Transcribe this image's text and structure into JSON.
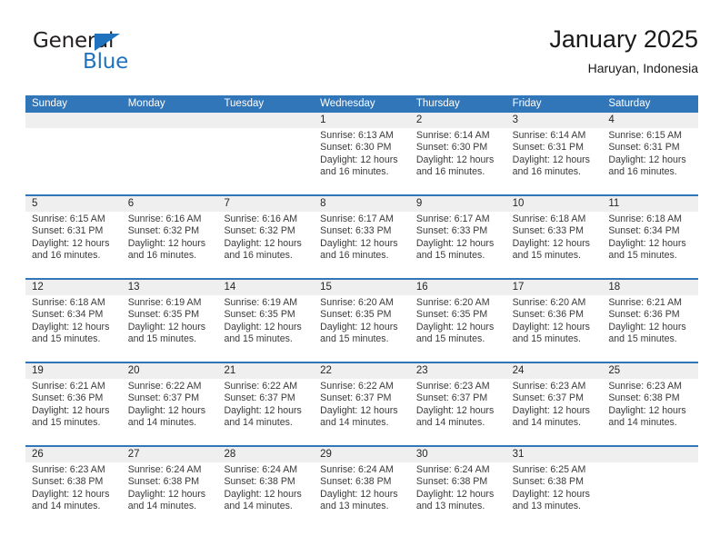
{
  "brand": {
    "name_part1": "General",
    "name_part2": "Blue",
    "triangle_color": "#1f72bd"
  },
  "header": {
    "title": "January 2025",
    "subtitle": "Haruyan, Indonesia"
  },
  "theme": {
    "header_blue": "#3176b9",
    "daynum_band": "#efefef",
    "text": "#3a3a3a"
  },
  "weekdays": [
    "Sunday",
    "Monday",
    "Tuesday",
    "Wednesday",
    "Thursday",
    "Friday",
    "Saturday"
  ],
  "weeks": [
    [
      {
        "day": "",
        "lines": [
          "",
          "",
          "",
          ""
        ]
      },
      {
        "day": "",
        "lines": [
          "",
          "",
          "",
          ""
        ]
      },
      {
        "day": "",
        "lines": [
          "",
          "",
          "",
          ""
        ]
      },
      {
        "day": "1",
        "lines": [
          "Sunrise: 6:13 AM",
          "Sunset: 6:30 PM",
          "Daylight: 12 hours",
          "and 16 minutes."
        ]
      },
      {
        "day": "2",
        "lines": [
          "Sunrise: 6:14 AM",
          "Sunset: 6:30 PM",
          "Daylight: 12 hours",
          "and 16 minutes."
        ]
      },
      {
        "day": "3",
        "lines": [
          "Sunrise: 6:14 AM",
          "Sunset: 6:31 PM",
          "Daylight: 12 hours",
          "and 16 minutes."
        ]
      },
      {
        "day": "4",
        "lines": [
          "Sunrise: 6:15 AM",
          "Sunset: 6:31 PM",
          "Daylight: 12 hours",
          "and 16 minutes."
        ]
      }
    ],
    [
      {
        "day": "5",
        "lines": [
          "Sunrise: 6:15 AM",
          "Sunset: 6:31 PM",
          "Daylight: 12 hours",
          "and 16 minutes."
        ]
      },
      {
        "day": "6",
        "lines": [
          "Sunrise: 6:16 AM",
          "Sunset: 6:32 PM",
          "Daylight: 12 hours",
          "and 16 minutes."
        ]
      },
      {
        "day": "7",
        "lines": [
          "Sunrise: 6:16 AM",
          "Sunset: 6:32 PM",
          "Daylight: 12 hours",
          "and 16 minutes."
        ]
      },
      {
        "day": "8",
        "lines": [
          "Sunrise: 6:17 AM",
          "Sunset: 6:33 PM",
          "Daylight: 12 hours",
          "and 16 minutes."
        ]
      },
      {
        "day": "9",
        "lines": [
          "Sunrise: 6:17 AM",
          "Sunset: 6:33 PM",
          "Daylight: 12 hours",
          "and 15 minutes."
        ]
      },
      {
        "day": "10",
        "lines": [
          "Sunrise: 6:18 AM",
          "Sunset: 6:33 PM",
          "Daylight: 12 hours",
          "and 15 minutes."
        ]
      },
      {
        "day": "11",
        "lines": [
          "Sunrise: 6:18 AM",
          "Sunset: 6:34 PM",
          "Daylight: 12 hours",
          "and 15 minutes."
        ]
      }
    ],
    [
      {
        "day": "12",
        "lines": [
          "Sunrise: 6:18 AM",
          "Sunset: 6:34 PM",
          "Daylight: 12 hours",
          "and 15 minutes."
        ]
      },
      {
        "day": "13",
        "lines": [
          "Sunrise: 6:19 AM",
          "Sunset: 6:35 PM",
          "Daylight: 12 hours",
          "and 15 minutes."
        ]
      },
      {
        "day": "14",
        "lines": [
          "Sunrise: 6:19 AM",
          "Sunset: 6:35 PM",
          "Daylight: 12 hours",
          "and 15 minutes."
        ]
      },
      {
        "day": "15",
        "lines": [
          "Sunrise: 6:20 AM",
          "Sunset: 6:35 PM",
          "Daylight: 12 hours",
          "and 15 minutes."
        ]
      },
      {
        "day": "16",
        "lines": [
          "Sunrise: 6:20 AM",
          "Sunset: 6:35 PM",
          "Daylight: 12 hours",
          "and 15 minutes."
        ]
      },
      {
        "day": "17",
        "lines": [
          "Sunrise: 6:20 AM",
          "Sunset: 6:36 PM",
          "Daylight: 12 hours",
          "and 15 minutes."
        ]
      },
      {
        "day": "18",
        "lines": [
          "Sunrise: 6:21 AM",
          "Sunset: 6:36 PM",
          "Daylight: 12 hours",
          "and 15 minutes."
        ]
      }
    ],
    [
      {
        "day": "19",
        "lines": [
          "Sunrise: 6:21 AM",
          "Sunset: 6:36 PM",
          "Daylight: 12 hours",
          "and 15 minutes."
        ]
      },
      {
        "day": "20",
        "lines": [
          "Sunrise: 6:22 AM",
          "Sunset: 6:37 PM",
          "Daylight: 12 hours",
          "and 14 minutes."
        ]
      },
      {
        "day": "21",
        "lines": [
          "Sunrise: 6:22 AM",
          "Sunset: 6:37 PM",
          "Daylight: 12 hours",
          "and 14 minutes."
        ]
      },
      {
        "day": "22",
        "lines": [
          "Sunrise: 6:22 AM",
          "Sunset: 6:37 PM",
          "Daylight: 12 hours",
          "and 14 minutes."
        ]
      },
      {
        "day": "23",
        "lines": [
          "Sunrise: 6:23 AM",
          "Sunset: 6:37 PM",
          "Daylight: 12 hours",
          "and 14 minutes."
        ]
      },
      {
        "day": "24",
        "lines": [
          "Sunrise: 6:23 AM",
          "Sunset: 6:37 PM",
          "Daylight: 12 hours",
          "and 14 minutes."
        ]
      },
      {
        "day": "25",
        "lines": [
          "Sunrise: 6:23 AM",
          "Sunset: 6:38 PM",
          "Daylight: 12 hours",
          "and 14 minutes."
        ]
      }
    ],
    [
      {
        "day": "26",
        "lines": [
          "Sunrise: 6:23 AM",
          "Sunset: 6:38 PM",
          "Daylight: 12 hours",
          "and 14 minutes."
        ]
      },
      {
        "day": "27",
        "lines": [
          "Sunrise: 6:24 AM",
          "Sunset: 6:38 PM",
          "Daylight: 12 hours",
          "and 14 minutes."
        ]
      },
      {
        "day": "28",
        "lines": [
          "Sunrise: 6:24 AM",
          "Sunset: 6:38 PM",
          "Daylight: 12 hours",
          "and 14 minutes."
        ]
      },
      {
        "day": "29",
        "lines": [
          "Sunrise: 6:24 AM",
          "Sunset: 6:38 PM",
          "Daylight: 12 hours",
          "and 13 minutes."
        ]
      },
      {
        "day": "30",
        "lines": [
          "Sunrise: 6:24 AM",
          "Sunset: 6:38 PM",
          "Daylight: 12 hours",
          "and 13 minutes."
        ]
      },
      {
        "day": "31",
        "lines": [
          "Sunrise: 6:25 AM",
          "Sunset: 6:38 PM",
          "Daylight: 12 hours",
          "and 13 minutes."
        ]
      },
      {
        "day": "",
        "lines": [
          "",
          "",
          "",
          ""
        ]
      }
    ]
  ]
}
